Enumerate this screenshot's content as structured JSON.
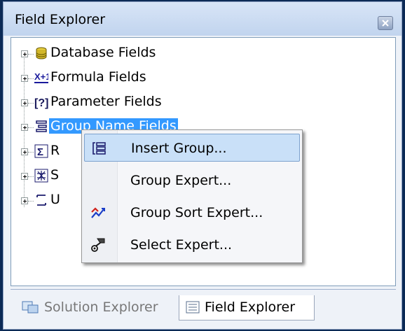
{
  "window": {
    "title": "Field Explorer"
  },
  "tree": {
    "items": [
      {
        "label": "Database Fields",
        "icon": "database-icon"
      },
      {
        "label": "Formula Fields",
        "icon": "formula-icon"
      },
      {
        "label": "Parameter Fields",
        "icon": "parameter-icon"
      },
      {
        "label": "Group Name Fields",
        "icon": "group-name-icon",
        "selected": true
      },
      {
        "label": "R",
        "icon": "sigma-icon"
      },
      {
        "label": "S",
        "icon": "special-fields-icon"
      },
      {
        "label": "U",
        "icon": "unbound-fields-icon"
      }
    ]
  },
  "context_menu": {
    "items": [
      {
        "label": "Insert Group...",
        "icon": "insert-group-icon",
        "highlighted": true
      },
      {
        "label": "Group Expert...",
        "icon": ""
      },
      {
        "label": "Group Sort Expert...",
        "icon": "group-sort-icon"
      },
      {
        "label": "Select Expert...",
        "icon": "select-expert-icon"
      }
    ]
  },
  "tabs": [
    {
      "label": "Solution Explorer",
      "icon": "solution-explorer-icon",
      "active": false
    },
    {
      "label": "Field Explorer",
      "icon": "field-explorer-icon",
      "active": true
    }
  ],
  "colors": {
    "selection": "#3399ff",
    "menu_highlight": "#c9e0f8",
    "title_bg": "#c1d4ee"
  }
}
